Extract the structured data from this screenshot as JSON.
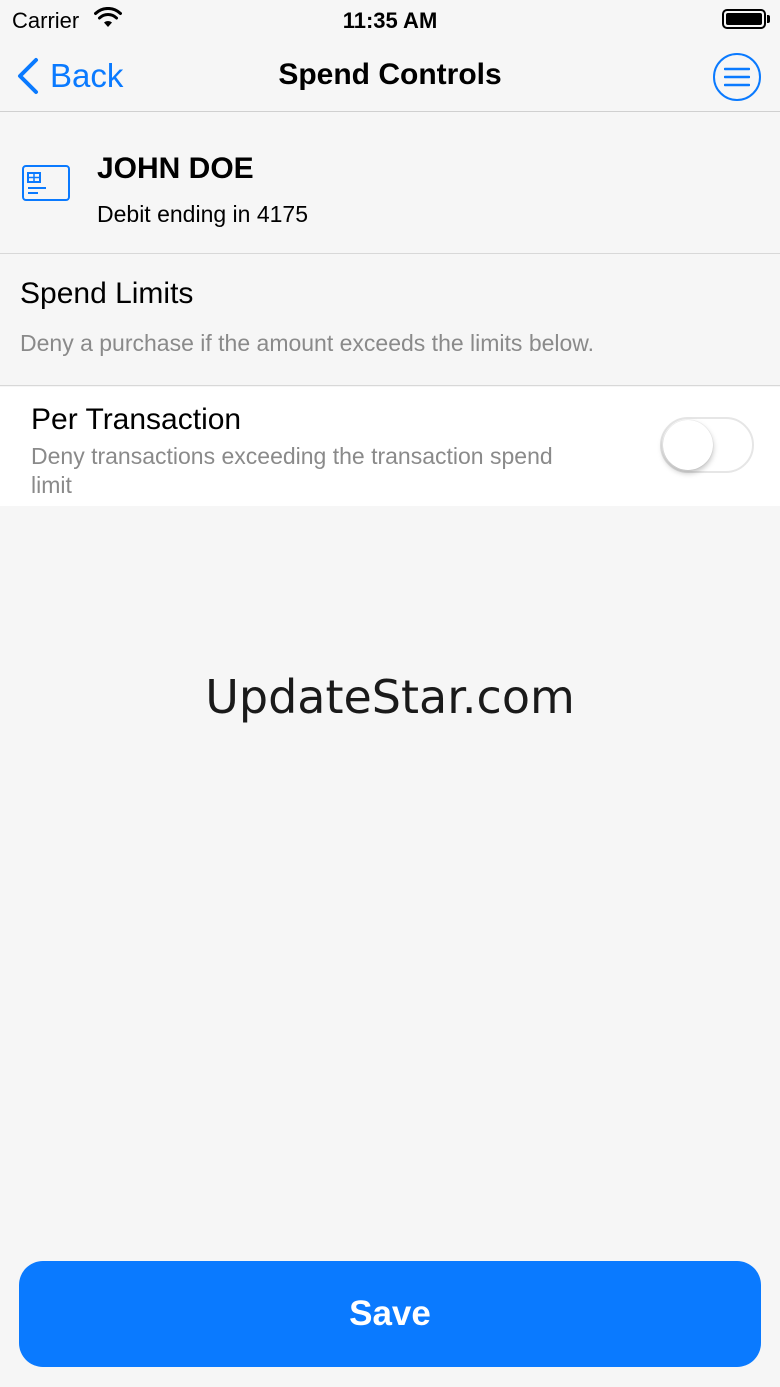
{
  "status_bar": {
    "carrier": "Carrier",
    "time": "11:35 AM",
    "wifi_icon": "wifi-icon",
    "battery_icon": "battery-full-icon"
  },
  "nav": {
    "back_label": "Back",
    "title": "Spend Controls",
    "back_icon": "chevron-left-icon",
    "menu_icon": "menu-icon",
    "accent_color": "#0a7aff"
  },
  "card": {
    "name": "JOHN DOE",
    "subtitle": "Debit ending in 4175",
    "icon": "credit-card-icon"
  },
  "spend_limits": {
    "title": "Spend Limits",
    "description": "Deny a purchase if the amount exceeds the limits below."
  },
  "per_transaction": {
    "title": "Per Transaction",
    "description": "Deny transactions exceeding the transaction spend limit",
    "enabled": false
  },
  "watermark": "UpdateStar.com",
  "save_label": "Save"
}
